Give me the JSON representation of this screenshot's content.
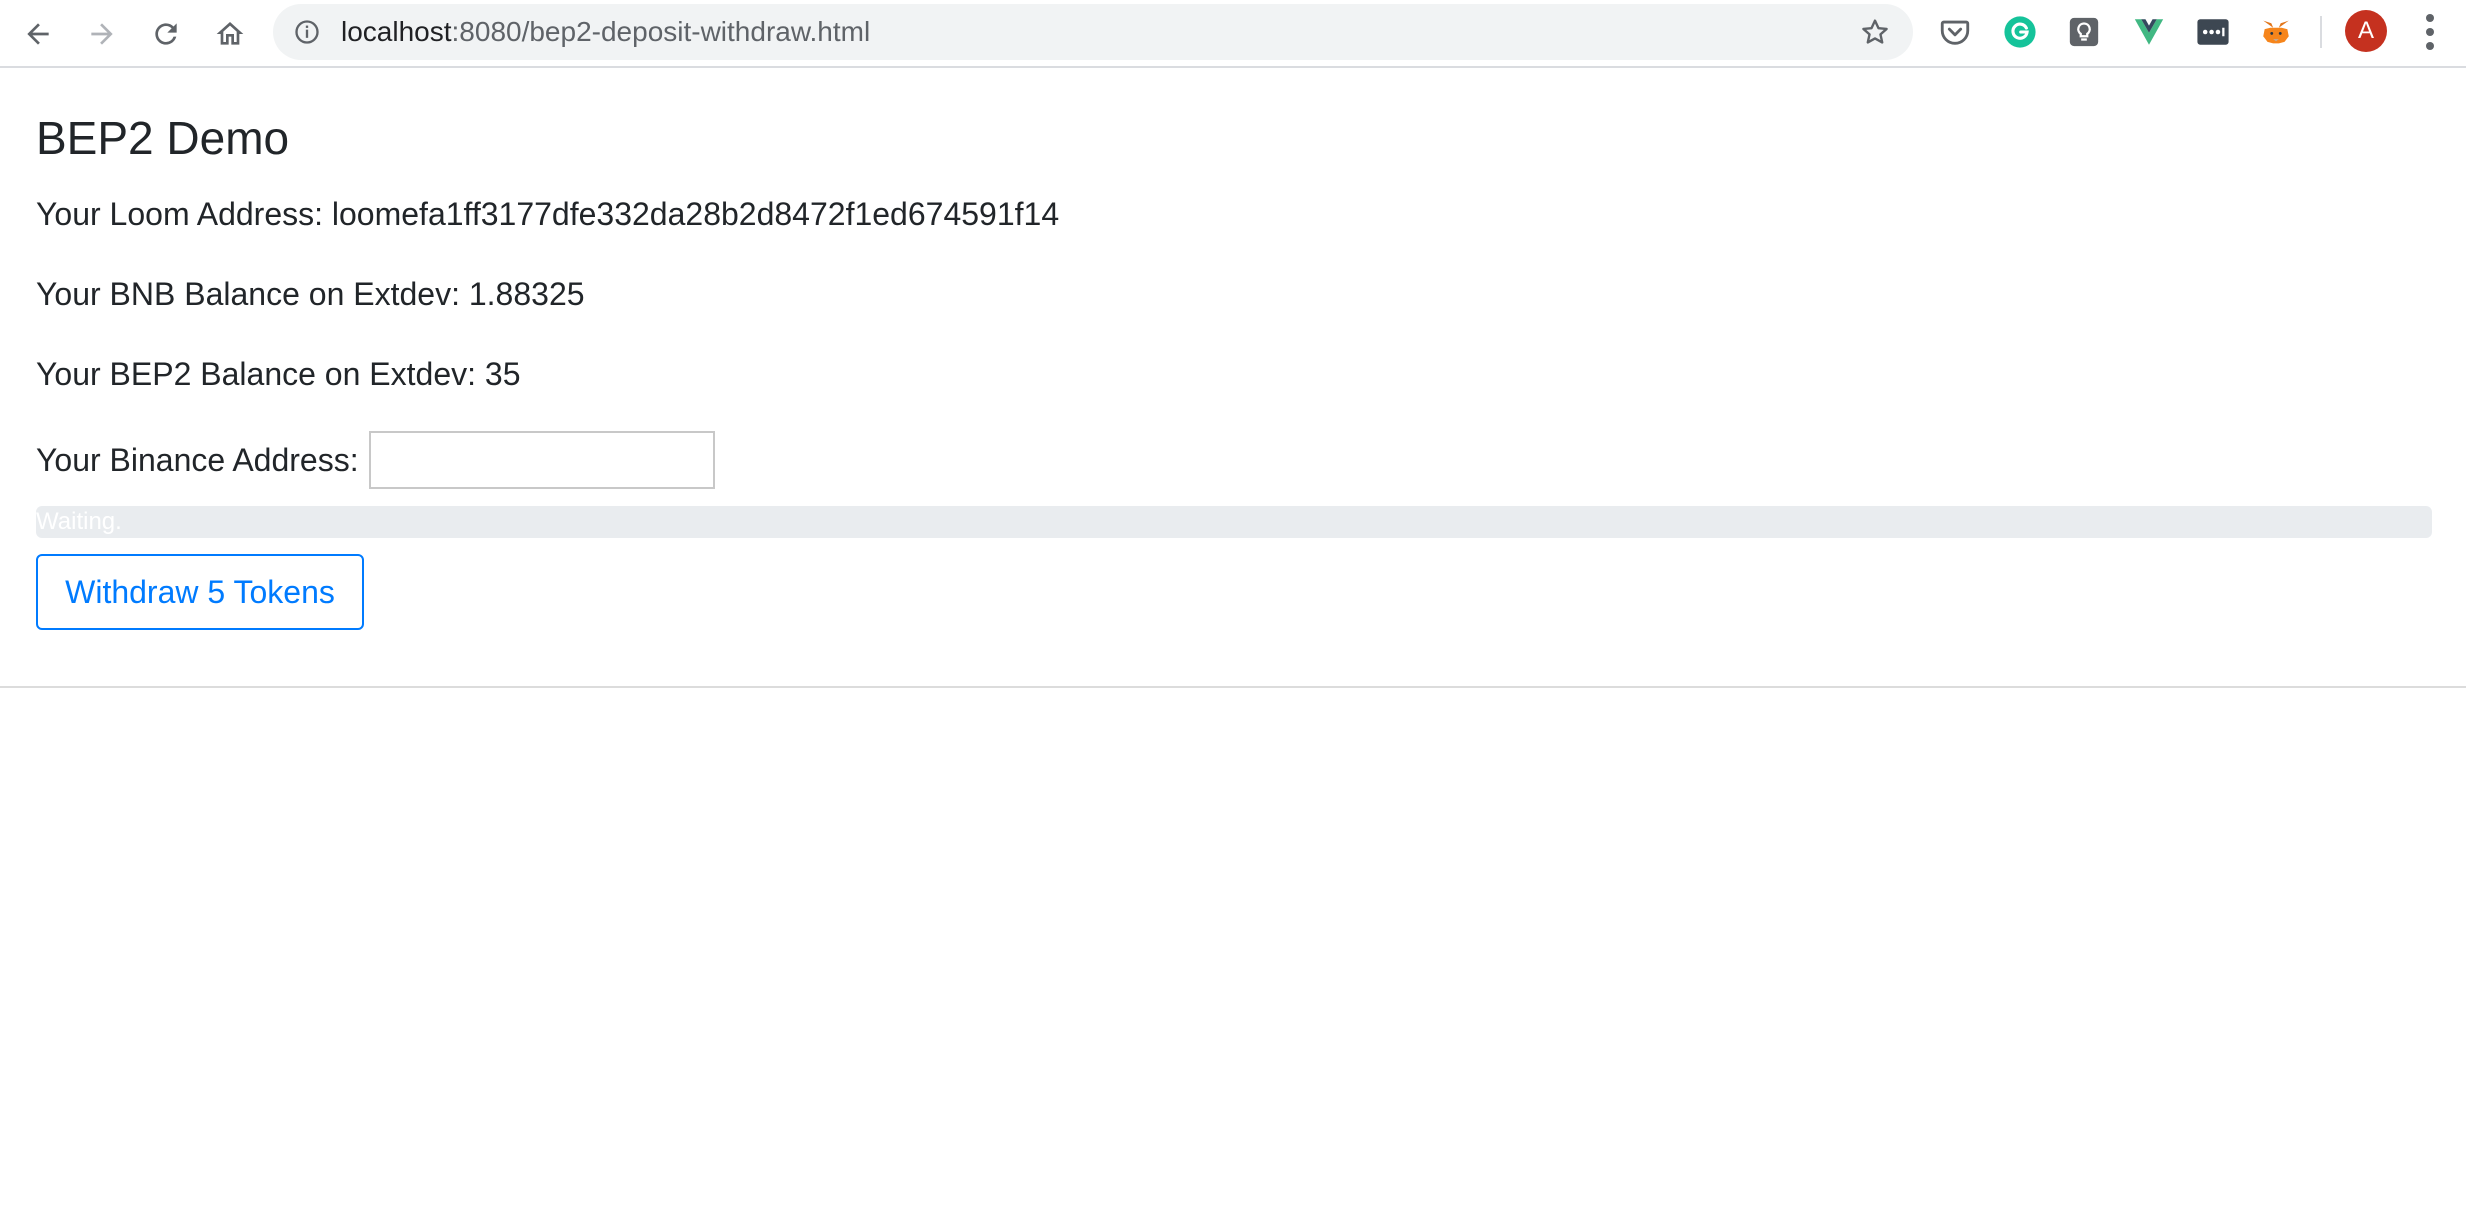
{
  "browser": {
    "url_host": "localhost",
    "url_rest": ":8080/bep2-deposit-withdraw.html",
    "profile_initial": "A",
    "extensions": [
      "pocket-icon",
      "grammarly-icon",
      "lightbulb-icon",
      "vue-devtools-icon",
      "password-manager-icon",
      "metamask-icon"
    ]
  },
  "page": {
    "title": "BEP2 Demo",
    "loom_address_line": "Your Loom Address: loomefa1ff3177dfe332da28b2d8472f1ed674591f14",
    "bnb_balance_line": "Your BNB Balance on Extdev: 1.88325",
    "bep2_balance_line": "Your BEP2 Balance on Extdev: 35",
    "binance_address_label": "Your Binance Address:",
    "binance_address_value": "",
    "progress": {
      "text": "Waiting.",
      "percent": 0,
      "fill_color": "#007bff"
    },
    "withdraw_button_label": "Withdraw 5 Tokens"
  },
  "colors": {
    "primary": "#007bff",
    "text": "#212529",
    "progress_track": "#e9ecef",
    "avatar": "#c5311f"
  }
}
